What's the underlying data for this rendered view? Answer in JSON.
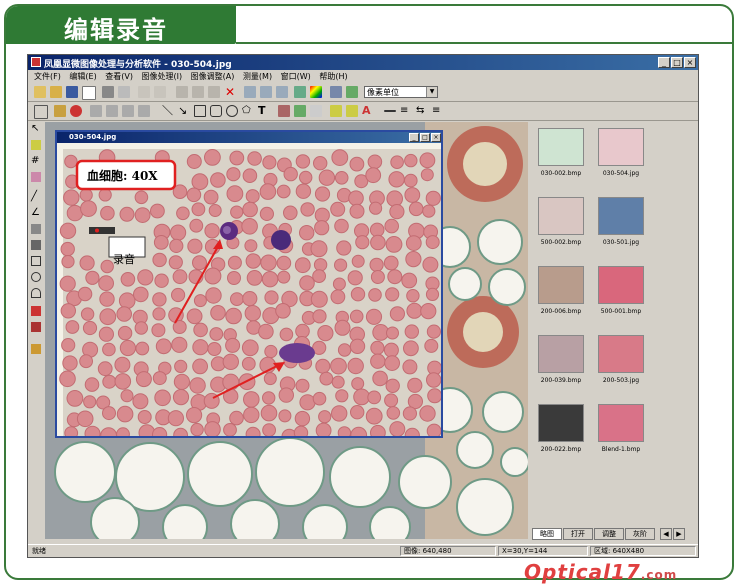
{
  "banner": {
    "title": "编辑录音"
  },
  "app": {
    "title": "凤凰显微图像处理与分析软件 - 030-504.jpg",
    "menu": [
      "文件(F)",
      "编辑(E)",
      "查看(V)",
      "图像处理(I)",
      "图像调整(A)",
      "测量(M)",
      "窗口(W)",
      "帮助(H)"
    ],
    "unit_select": "像素单位"
  },
  "image_window": {
    "title": "030-504.jpg",
    "caption": "血细胞: 40X",
    "audio_label": "录音"
  },
  "thumbnails": [
    {
      "label": "030-002.bmp",
      "color": "#cfe4d2"
    },
    {
      "label": "030-504.jpg",
      "color": "#e8c8cc"
    },
    {
      "label": "500-002.bmp",
      "color": "#d9c6c2"
    },
    {
      "label": "030-501.jpg",
      "color": "#5f7fa8"
    },
    {
      "label": "200-006.bmp",
      "color": "#b89c8c"
    },
    {
      "label": "500-001.bmp",
      "color": "#d9677c"
    },
    {
      "label": "200-039.bmp",
      "color": "#b8a0a4"
    },
    {
      "label": "200-503.jpg",
      "color": "#d87a88"
    },
    {
      "label": "200-022.bmp",
      "color": "#3a3a3a"
    },
    {
      "label": "Blend-1.bmp",
      "color": "#d97288"
    }
  ],
  "tabs": [
    "略图",
    "打开",
    "调整",
    "灰阶"
  ],
  "status": {
    "ready": "就绪",
    "image_size": "图像: 640,480",
    "coords": "X=30,Y=144",
    "region": "区域: 640X480"
  },
  "watermark": {
    "text": "Optical17",
    "suffix": ".com"
  }
}
